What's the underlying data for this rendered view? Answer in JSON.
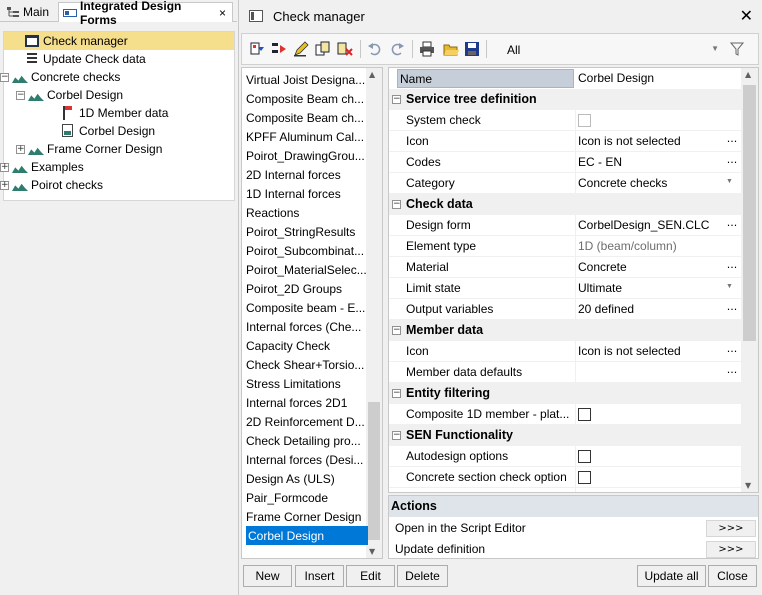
{
  "tabs": {
    "main": "Main",
    "idf": "Integrated Design Forms",
    "close": "×"
  },
  "tree": [
    {
      "label": "Check manager",
      "icon": "frame-icon",
      "selected": true
    },
    {
      "label": "Update Check data",
      "icon": "list-icon"
    },
    {
      "label": "Concrete checks",
      "icon": "hill-icon",
      "toggle": "−"
    },
    {
      "label": "Corbel Design",
      "icon": "hill-icon",
      "toggle": "−"
    },
    {
      "label": "1D Member data",
      "icon": "member-icon"
    },
    {
      "label": "Corbel Design",
      "icon": "doc-icon"
    },
    {
      "label": "Frame Corner Design",
      "icon": "hill-icon",
      "toggle": "+"
    },
    {
      "label": "Examples",
      "icon": "hill-icon",
      "toggle": "+"
    },
    {
      "label": "Poirot checks",
      "icon": "hill-icon",
      "toggle": "+"
    }
  ],
  "dialog": {
    "title": "Check manager",
    "close": "✕"
  },
  "toolbar": {
    "filter_value": "All"
  },
  "list": [
    "Virtual Joist Designa...",
    "Composite Beam ch...",
    "Composite Beam ch...",
    "KPFF Aluminum Cal...",
    "Poirot_DrawingGrou...",
    "2D Internal forces",
    "1D Internal forces",
    "Reactions",
    "Poirot_StringResults",
    "Poirot_Subcombinat...",
    "Poirot_MaterialSelec...",
    "Poirot_2D Groups",
    "Composite beam - E...",
    "Internal forces (Che...",
    "Capacity Check",
    "Check Shear+Torsio...",
    "Stress Limitations",
    "Internal forces 2D1",
    "2D Reinforcement D...",
    "Check Detailing pro...",
    "Internal forces (Desi...",
    "Design As (ULS)",
    "Pair_Formcode",
    "Frame Corner Design",
    "Corbel Design"
  ],
  "props": {
    "header": {
      "name": "Name",
      "value": "Corbel Design"
    },
    "rows": [
      {
        "type": "cat",
        "label": "Service tree definition",
        "toggle": "−"
      },
      {
        "type": "row",
        "key": "System check",
        "check": "disabled"
      },
      {
        "type": "row",
        "key": "Icon",
        "value": "Icon is not selected",
        "ellipsis": "..."
      },
      {
        "type": "row",
        "key": "Codes",
        "value": "EC - EN",
        "ellipsis": "..."
      },
      {
        "type": "row",
        "key": "Category",
        "value": "Concrete checks",
        "dropdown": true
      },
      {
        "type": "cat",
        "label": "Check data",
        "toggle": "−"
      },
      {
        "type": "row",
        "key": "Design form",
        "value": "CorbelDesign_SEN.CLC",
        "ellipsis": "..."
      },
      {
        "type": "row",
        "key": "Element type",
        "value": "1D (beam/column)",
        "grey": true
      },
      {
        "type": "row",
        "key": "Material",
        "value": "Concrete",
        "ellipsis": "..."
      },
      {
        "type": "row",
        "key": "Limit state",
        "value": "Ultimate",
        "dropdown": true
      },
      {
        "type": "row",
        "key": "Output variables",
        "value": "20 defined",
        "ellipsis": "..."
      },
      {
        "type": "cat",
        "label": "Member data",
        "toggle": "−"
      },
      {
        "type": "row",
        "key": "Icon",
        "value": "Icon is not selected",
        "ellipsis": "..."
      },
      {
        "type": "row",
        "key": "Member data defaults",
        "value": "",
        "ellipsis": "..."
      },
      {
        "type": "cat",
        "label": "Entity filtering",
        "toggle": "−"
      },
      {
        "type": "row",
        "key": "Composite 1D member - plat...",
        "check": "enabled"
      },
      {
        "type": "cat",
        "label": "SEN Functionality",
        "toggle": "−"
      },
      {
        "type": "row",
        "key": "Autodesign options",
        "check": "enabled"
      },
      {
        "type": "row",
        "key": "Concrete section check option",
        "check": "enabled"
      },
      {
        "type": "row",
        "key": "",
        "check": "disabled"
      }
    ]
  },
  "actions": {
    "header": "Actions",
    "items": [
      {
        "label": "Open in the Script Editor",
        "button": ">>>"
      },
      {
        "label": "Update definition",
        "button": ">>>"
      }
    ]
  },
  "buttons": {
    "new": "New",
    "insert": "Insert",
    "edit": "Edit",
    "delete": "Delete",
    "update_all": "Update all",
    "close": "Close"
  },
  "colors": {
    "selection": "#0078d7",
    "tree_selection": "#f5de8c",
    "accent_green": "#2e7d6f"
  }
}
